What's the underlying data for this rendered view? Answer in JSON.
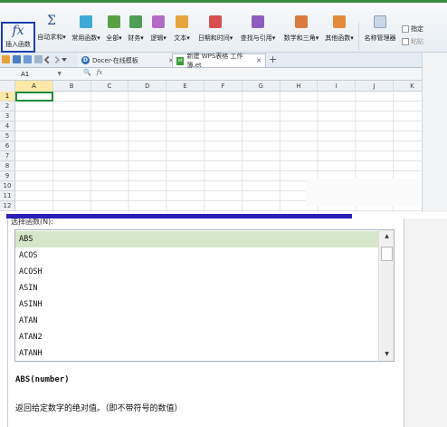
{
  "ribbon": {
    "insert_function": "插入函数",
    "autosum": "自动求和",
    "common_functions": "常用函数",
    "all": "全部",
    "financial": "财务",
    "logical": "逻辑",
    "text": "文本",
    "datetime": "日期和时间",
    "lookup": "查找与引用",
    "math_trig": "数学和三角",
    "other_functions": "其他函数",
    "name_manager": "名称管理器",
    "define_name": "指定",
    "paste": "粘贴",
    "icon_colors": {
      "common": "#3fa9d8",
      "all": "#5b9f45",
      "financial": "#4e9e55",
      "logical": "#b36bc9",
      "text": "#e6a53a",
      "datetime": "#d94f4f",
      "lookup": "#8e5cbf",
      "math": "#d97b3f",
      "other": "#e38a3b"
    }
  },
  "tabs": {
    "docer": "Docer-在线模板",
    "workbook": "新建 WPS表格 工作簿.et",
    "close_glyph": "✕",
    "add_glyph": "+",
    "docer_badge": "D",
    "et_badge": "et"
  },
  "formula_bar": {
    "cell_ref": "A1",
    "zoom_glyph": "🔍",
    "fx_glyph": "fx"
  },
  "sheet": {
    "columns": [
      "A",
      "B",
      "C",
      "D",
      "E",
      "F",
      "G",
      "H",
      "I",
      "J",
      "K"
    ],
    "rows": [
      "1",
      "2",
      "3",
      "4",
      "5",
      "6",
      "7",
      "8",
      "9",
      "10",
      "11",
      "12"
    ],
    "selected_cell": "A1"
  },
  "dialog": {
    "select_function_label": "选择函数(N):",
    "functions": [
      "ABS",
      "ACOS",
      "ACOSH",
      "ASIN",
      "ASINH",
      "ATAN",
      "ATAN2",
      "ATANH"
    ],
    "selected_function": "ABS",
    "syntax": "ABS(number)",
    "description": "返回给定数字的绝对值。（即不带符号的数值）"
  },
  "colors": {
    "accent_green": "#3d8c40",
    "fx_highlight": "#1e3fae",
    "selected_row_bg": "#d6e6c8",
    "purple_bar": "#2b1fb8"
  }
}
